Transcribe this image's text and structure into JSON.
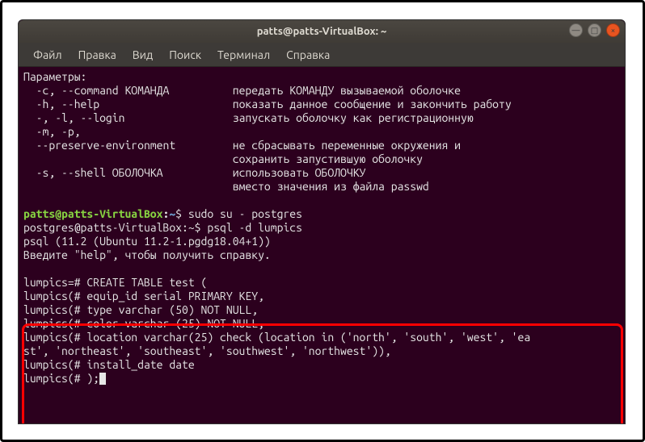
{
  "titlebar": {
    "text": "patts@patts-VirtualBox: ~"
  },
  "window_controls": {
    "minimize": "—",
    "maximize": "□",
    "close": "×"
  },
  "menu": {
    "file": "Файл",
    "edit": "Правка",
    "view": "Вид",
    "search": "Поиск",
    "terminal": "Терминал",
    "help": "Справка"
  },
  "terminal": {
    "params_header": "Параметры:",
    "opt_c_left": "  -c, --command КОМАНДА",
    "opt_c_right": "передать КОМАНДУ вызываемой оболочке",
    "opt_h_left": "  -h, --help",
    "opt_h_right": "показать данное сообщение и закончить работу",
    "opt_l_left": "  -, -l, --login",
    "opt_l_right": "запускать оболочку как регистрационную",
    "opt_mp": "  -m, -p,",
    "opt_pe_left": "  --preserve-environment",
    "opt_pe_r1": "не сбрасывать переменные окружения и",
    "opt_pe_r2": "сохранить запустившую оболочку",
    "opt_s_left": "  -s, --shell ОБОЛОЧКА",
    "opt_s_r1": "использовать ОБОЛОЧКУ",
    "opt_s_r2": "вместо значения из файла passwd",
    "prompt1_user": "patts@patts-VirtualBox",
    "prompt1_path": "~",
    "prompt1_cmd": "sudo su - postgres",
    "line_pg_prompt": "postgres@patts-VirtualBox:~$ psql -d lumpics",
    "line_psql_ver": "psql (11.2 (Ubuntu 11.2-1.pgdg18.04+1))",
    "line_help": "Введите \"help\", чтобы получить справку.",
    "sql1": "lumpics=# CREATE TABLE test (",
    "sql2": "lumpics(# equip_id serial PRIMARY KEY,",
    "sql3": "lumpics(# type varchar (50) NOT NULL,",
    "sql4": "lumpics(# color varchar (25) NOT NULL,",
    "sql5": "lumpics(# location varchar(25) check (location in ('north', 'south', 'west', 'ea",
    "sql6": "st', 'northeast', 'southeast', 'southwest', 'northwest')),",
    "sql7": "lumpics(# install_date date",
    "sql8": "lumpics(# );"
  }
}
